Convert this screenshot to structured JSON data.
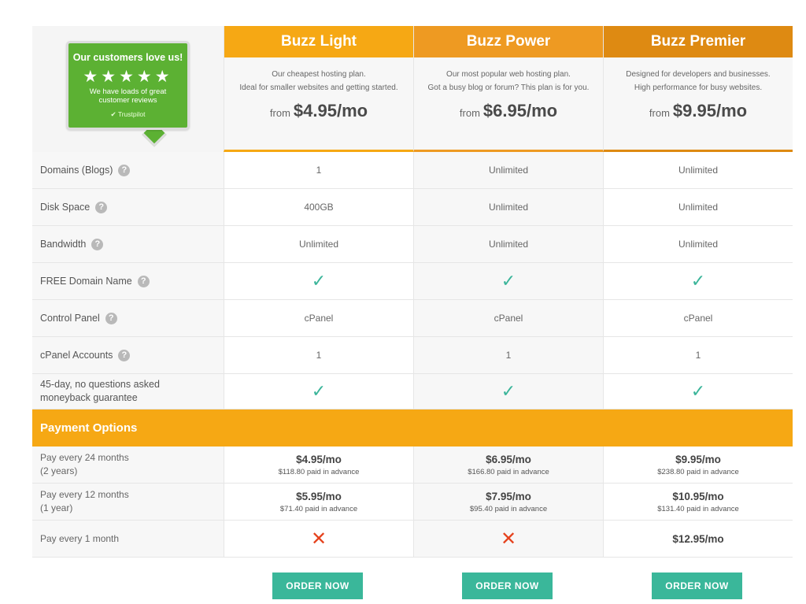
{
  "badge": {
    "title": "Our customers love us!",
    "stars": "★★★★★",
    "text": "We have loads of great customer reviews",
    "brand": "Trustpilot",
    "color": "#5cb133"
  },
  "plans": [
    {
      "name": "Buzz Light",
      "color": "#f6a814",
      "desc_line1": "Our cheapest hosting plan.",
      "desc_line2": "Ideal for smaller websites and getting started.",
      "from": "from",
      "price": "$4.95/mo"
    },
    {
      "name": "Buzz Power",
      "color": "#ee9a22",
      "desc_line1": "Our most popular web hosting plan.",
      "desc_line2": "Got a busy blog or forum? This plan is for you.",
      "from": "from",
      "price": "$6.95/mo"
    },
    {
      "name": "Buzz Premier",
      "color": "#de8a12",
      "desc_line1": "Designed for developers and businesses.",
      "desc_line2": "High performance for busy websites.",
      "from": "from",
      "price": "$9.95/mo"
    }
  ],
  "features": [
    {
      "label": "Domains (Blogs)",
      "help": true,
      "values": [
        "1",
        "Unlimited",
        "Unlimited"
      ]
    },
    {
      "label": "Disk Space",
      "help": true,
      "values": [
        "400GB",
        "Unlimited",
        "Unlimited"
      ]
    },
    {
      "label": "Bandwidth",
      "help": true,
      "values": [
        "Unlimited",
        "Unlimited",
        "Unlimited"
      ]
    },
    {
      "label": "FREE Domain Name",
      "help": true,
      "values": [
        "✓",
        "✓",
        "✓"
      ]
    },
    {
      "label": "Control Panel",
      "help": true,
      "values": [
        "cPanel",
        "cPanel",
        "cPanel"
      ]
    },
    {
      "label": "cPanel Accounts",
      "help": true,
      "values": [
        "1",
        "1",
        "1"
      ]
    },
    {
      "label": "45-day, no questions asked moneyback guarantee",
      "help": false,
      "values": [
        "✓",
        "✓",
        "✓"
      ]
    }
  ],
  "help_glyph": "?",
  "payment_header": "Payment Options",
  "payments": [
    {
      "label_line1": "Pay every 24 months",
      "label_line2": "(2 years)",
      "values": [
        {
          "main": "$4.95/mo",
          "sub": "$118.80 paid in advance"
        },
        {
          "main": "$6.95/mo",
          "sub": "$166.80 paid in advance"
        },
        {
          "main": "$9.95/mo",
          "sub": "$238.80 paid in advance"
        }
      ]
    },
    {
      "label_line1": "Pay every 12 months",
      "label_line2": "(1 year)",
      "values": [
        {
          "main": "$5.95/mo",
          "sub": "$71.40 paid in advance"
        },
        {
          "main": "$7.95/mo",
          "sub": "$95.40 paid in advance"
        },
        {
          "main": "$10.95/mo",
          "sub": "$131.40 paid in advance"
        }
      ]
    },
    {
      "label_line1": "Pay every 1 month",
      "label_line2": "",
      "values": [
        {
          "main": "✕",
          "sub": ""
        },
        {
          "main": "✕",
          "sub": ""
        },
        {
          "main": "$12.95/mo",
          "sub": ""
        }
      ]
    }
  ],
  "order_button_label": "ORDER NOW",
  "colors": {
    "check": "#3bb59a",
    "cross": "#e5421d",
    "button": "#3ab79a",
    "payment_header": "#f6a814"
  }
}
